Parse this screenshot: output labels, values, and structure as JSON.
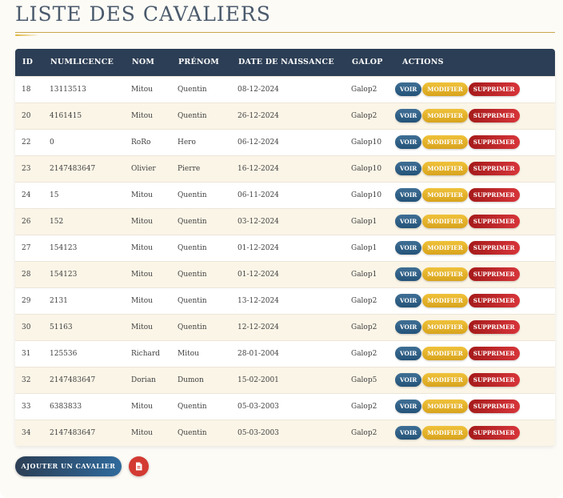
{
  "page": {
    "title": "LISTE DES CAVALIERS"
  },
  "table": {
    "headers": {
      "id": "ID",
      "numlicence": "NUMLICENCE",
      "nom": "NOM",
      "prenom": "PRÉNOM",
      "date": "DATE DE NAISSANCE",
      "galop": "GALOP",
      "actions": "ACTIONS"
    },
    "action_labels": {
      "voir": "VOIR",
      "modifier": "MODIFIER",
      "supprimer": "SUPPRIMER"
    },
    "rows": [
      {
        "id": "18",
        "numlicence": "13113513",
        "nom": "Mitou",
        "prenom": "Quentin",
        "date": "08-12-2024",
        "galop": "Galop2"
      },
      {
        "id": "20",
        "numlicence": "4161415",
        "nom": "Mitou",
        "prenom": "Quentin",
        "date": "26-12-2024",
        "galop": "Galop2"
      },
      {
        "id": "22",
        "numlicence": "0",
        "nom": "RoRo",
        "prenom": "Hero",
        "date": "06-12-2024",
        "galop": "Galop10"
      },
      {
        "id": "23",
        "numlicence": "2147483647",
        "nom": "Olivier",
        "prenom": "Pierre",
        "date": "16-12-2024",
        "galop": "Galop10"
      },
      {
        "id": "24",
        "numlicence": "15",
        "nom": "Mitou",
        "prenom": "Quentin",
        "date": "06-11-2024",
        "galop": "Galop10"
      },
      {
        "id": "26",
        "numlicence": "152",
        "nom": "Mitou",
        "prenom": "Quentin",
        "date": "03-12-2024",
        "galop": "Galop1"
      },
      {
        "id": "27",
        "numlicence": "154123",
        "nom": "Mitou",
        "prenom": "Quentin",
        "date": "01-12-2024",
        "galop": "Galop1"
      },
      {
        "id": "28",
        "numlicence": "154123",
        "nom": "Mitou",
        "prenom": "Quentin",
        "date": "01-12-2024",
        "galop": "Galop1"
      },
      {
        "id": "29",
        "numlicence": "2131",
        "nom": "Mitou",
        "prenom": "Quentin",
        "date": "13-12-2024",
        "galop": "Galop2"
      },
      {
        "id": "30",
        "numlicence": "51163",
        "nom": "Mitou",
        "prenom": "Quentin",
        "date": "12-12-2024",
        "galop": "Galop2"
      },
      {
        "id": "31",
        "numlicence": "125536",
        "nom": "Richard",
        "prenom": "Mitou",
        "date": "28-01-2004",
        "galop": "Galop2"
      },
      {
        "id": "32",
        "numlicence": "2147483647",
        "nom": "Dorian",
        "prenom": "Dumon",
        "date": "15-02-2001",
        "galop": "Galop5"
      },
      {
        "id": "33",
        "numlicence": "6383833",
        "nom": "Mitou",
        "prenom": "Quentin",
        "date": "05-03-2003",
        "galop": "Galop2"
      },
      {
        "id": "34",
        "numlicence": "2147483647",
        "nom": "Mitou",
        "prenom": "Quentin",
        "date": "05-03-2003",
        "galop": "Galop2"
      }
    ]
  },
  "footer": {
    "add_label": "AJOUTER UN CAVALIER",
    "pdf_icon": "pdf-file-icon"
  },
  "colors": {
    "header_bg": "#2c3e55",
    "voir": "#2f6189",
    "modifier": "#e5b42a",
    "supprimer": "#c0282c",
    "pdf": "#d33a32",
    "title_rule": "#c9a74a"
  }
}
